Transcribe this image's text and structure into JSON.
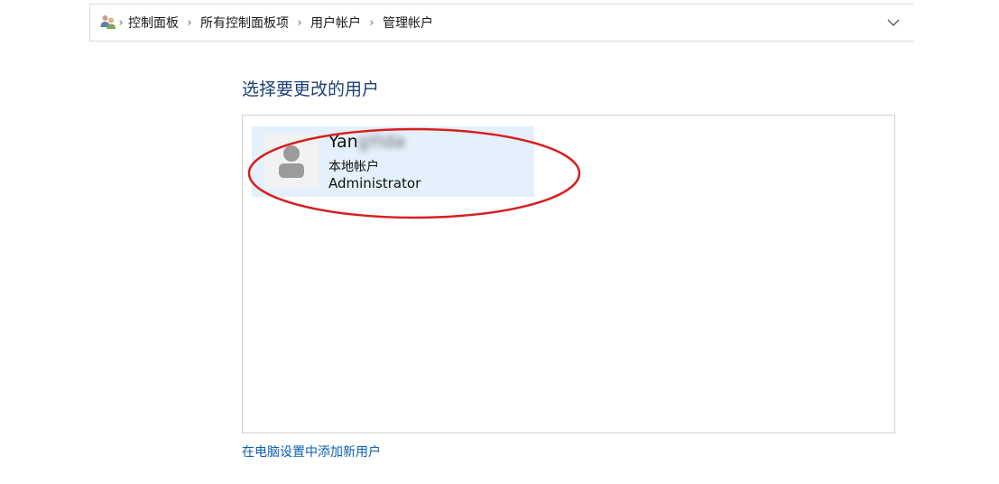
{
  "address_bar": {
    "icon": "users-icon",
    "breadcrumbs": [
      "控制面板",
      "所有控制面板项",
      "用户帐户",
      "管理帐户"
    ],
    "separator": "›",
    "dropdown_icon": "chevron-down-icon"
  },
  "main": {
    "heading": "选择要更改的用户",
    "accounts": [
      {
        "name_visible": "Yan",
        "name_obscured": "gYida",
        "type": "本地帐户",
        "role": "Administrator",
        "avatar_icon": "user-avatar-icon"
      }
    ],
    "add_user_link": "在电脑设置中添加新用户"
  },
  "annotation": {
    "color": "#d81e1e",
    "shape": "ellipse-highlight"
  }
}
